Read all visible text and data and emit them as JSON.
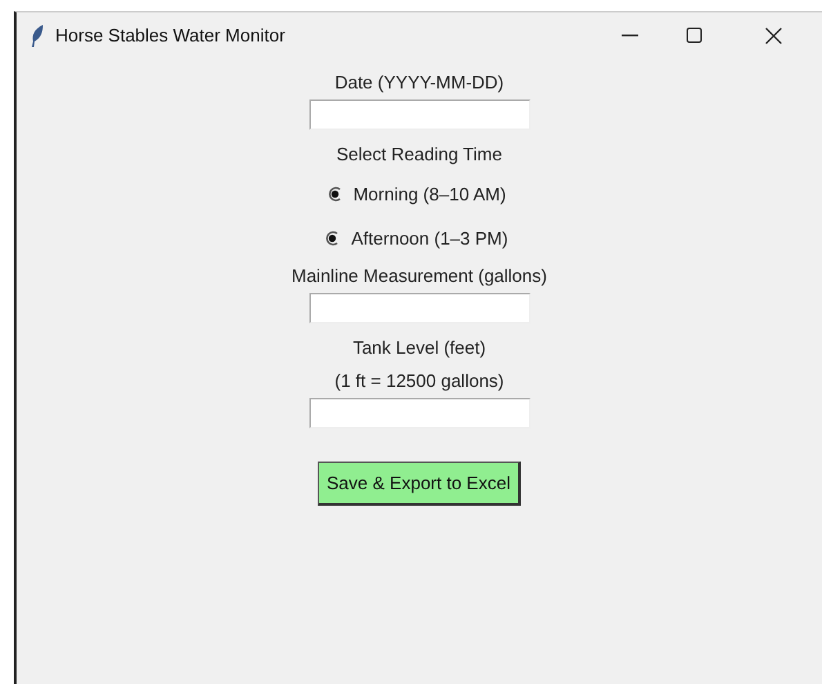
{
  "window": {
    "title": "Horse Stables Water Monitor"
  },
  "form": [
    {
      "kind": "label",
      "text": "Date (YYYY-MM-DD)"
    },
    {
      "kind": "entry"
    },
    {
      "kind": "label",
      "text": "Select Reading Time"
    },
    {
      "kind": "radio",
      "label": "Morning (8–10 AM)",
      "selected": true
    },
    {
      "kind": "radio",
      "label": "Afternoon (1–3 PM)",
      "selected": true
    },
    {
      "kind": "label",
      "text": "Mainline Measurement (gallons)"
    },
    {
      "kind": "entry"
    },
    {
      "kind": "label",
      "text": "Tank Level (feet)"
    },
    {
      "kind": "label",
      "text": "(1 ft = 12500 gallons)"
    },
    {
      "kind": "entry"
    },
    {
      "kind": "button",
      "label": "Save & Export to Excel"
    }
  ]
}
